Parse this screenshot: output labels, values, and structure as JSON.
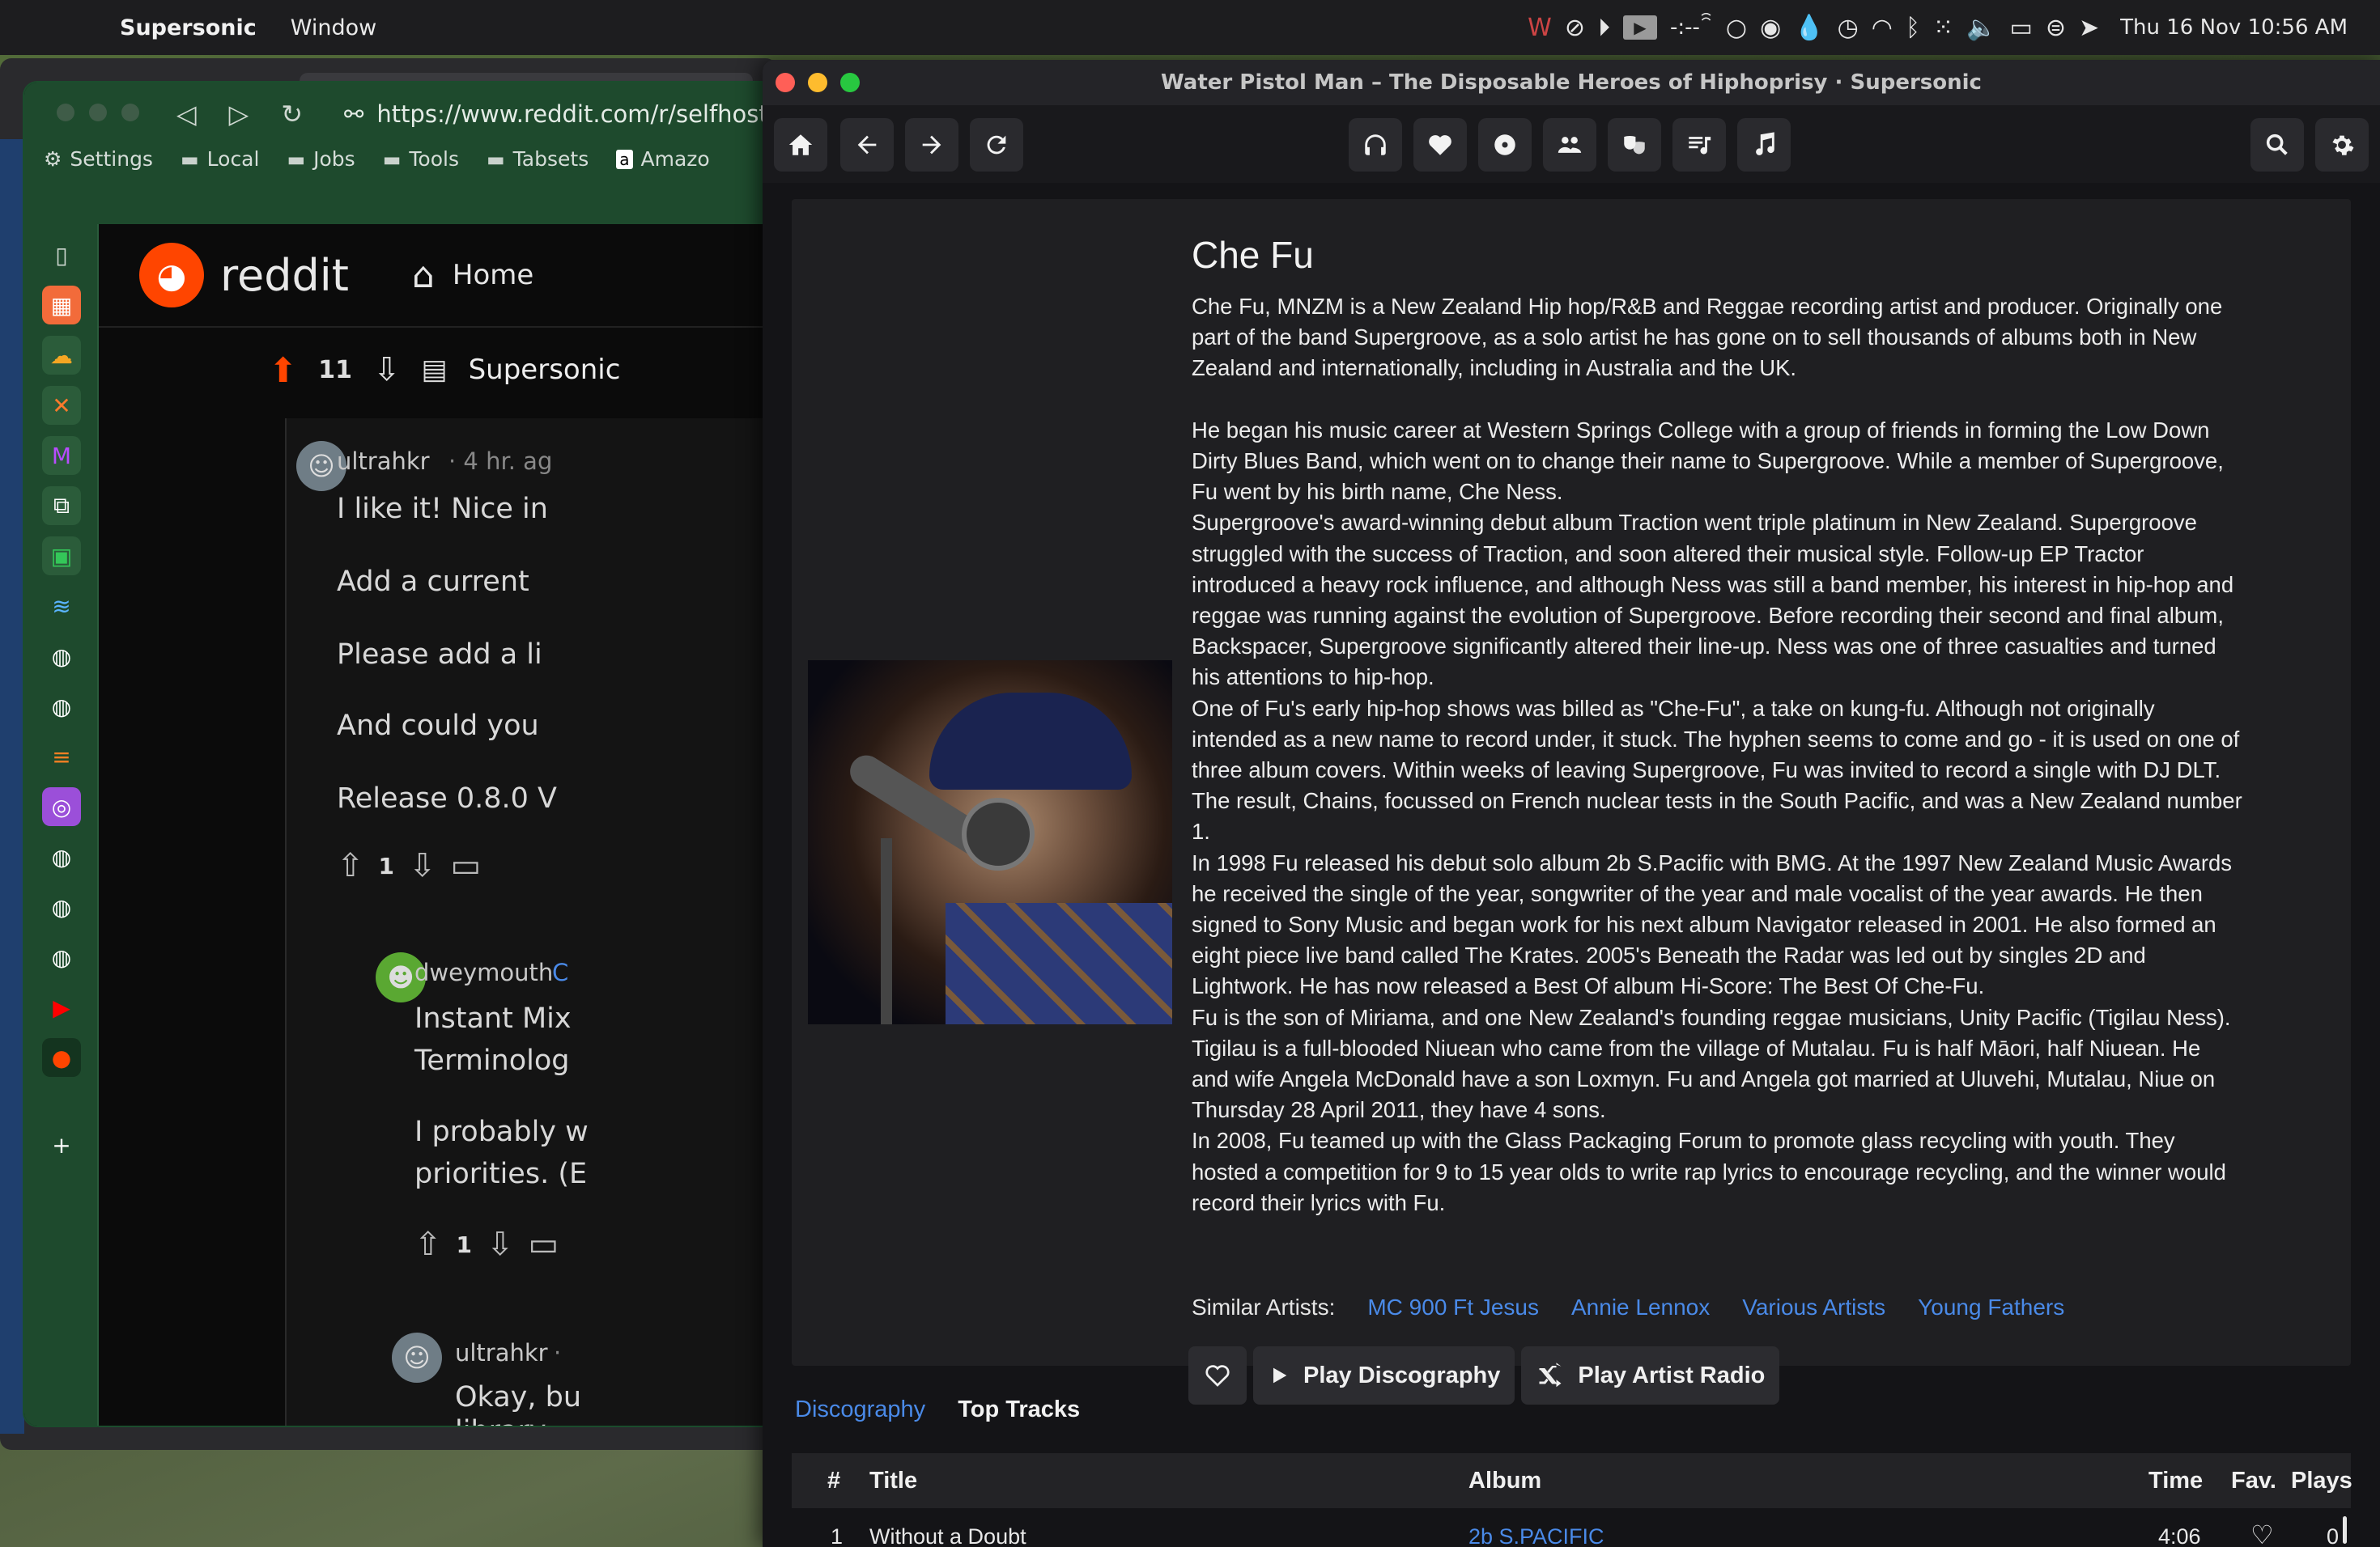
{
  "menubar": {
    "app_name": "Supersonic",
    "menu_window": "Window",
    "clock": "Thu 16 Nov  10:56 AM",
    "timer": "-:--"
  },
  "browser": {
    "url": "https://www.reddit.com/r/selfhosted",
    "bookmarks": [
      "Settings",
      "Local",
      "Jobs",
      "Tools",
      "Tabsets",
      "Amazo"
    ],
    "reddit_word": "reddit",
    "home_label": "Home",
    "post": {
      "score": "11",
      "title": "Supersonic"
    },
    "comments": {
      "c1_user": "ultrahkr",
      "c1_meta": "· 4 hr. ag",
      "c1_l1": "I like it! Nice in",
      "c1_l2": "Add a current",
      "c1_l3": "Please add a li",
      "c1_l4": "And could you",
      "c1_l5": "Release 0.8.0 V",
      "c1_votes": "1",
      "c2_user": "dweymouth",
      "c2_tag": "C",
      "c2_l1": "Instant Mix",
      "c2_l2": "Terminolog",
      "c2_l3": "I probably w",
      "c2_l4": "priorities. (E",
      "c2_votes": "1",
      "c3_user": "ultrahkr",
      "c3_meta": "·",
      "c3_l1": "Okay, bu",
      "c3_l2": "library"
    }
  },
  "sonic": {
    "window_title": "Water Pistol Man – The Disposable Heroes of Hiphoprisy · Supersonic",
    "artist_name": "Che Fu",
    "bio": "Che Fu, MNZM is a New Zealand Hip hop/R&B and Reggae recording artist and producer. Originally one\npart of the band Supergroove, as a solo artist he has gone on to sell thousands of albums both in New\nZealand and internationally, including in Australia and the UK.\n\nHe began his music career at Western Springs College with a group of friends in forming the Low Down\nDirty Blues Band, which went on to change their name to Supergroove. While a member of Supergroove,\nFu went by his birth name, Che Ness.\nSupergroove's award-winning debut album Traction went triple platinum in New Zealand. Supergroove\nstruggled with the success of Traction, and soon altered their musical style. Follow-up EP Tractor\nintroduced a heavy rock influence, and although Ness was still a band member, his interest in hip-hop and\nreggae was running against the evolution of Supergroove. Before recording their second and final album,\nBackspacer, Supergroove significantly altered their line-up. Ness was one of three casualties and turned\nhis attentions to hip-hop.\nOne of Fu's early hip-hop shows was billed as \"Che-Fu\", a take on kung-fu. Although not originally\nintended as a new name to record under, it stuck. The hyphen seems to come and go - it is used on one of\nthree album covers. Within weeks of leaving Supergroove, Fu was invited to record a single with DJ DLT.\nThe result, Chains, focussed on French nuclear tests in the South Pacific, and was a New Zealand number\n1.\nIn 1998 Fu released his debut solo album 2b S.Pacific with BMG. At the 1997 New Zealand Music Awards\nhe received the single of the year, songwriter of the year and male vocalist of the year awards. He then\nsigned to Sony Music and began work for his next album Navigator released in 2001. He also formed an\neight piece live band called The Krates. 2005's Beneath the Radar was led out by singles 2D and\nLightwork. He has now released a Best Of album Hi-Score: The Best Of Che-Fu.\nFu is the son of Miriama, and one New Zealand's founding reggae musicians, Unity Pacific (Tigilau Ness).\nTigilau is a full-blooded Niuean who came from the village of Mutalau. Fu is half Māori, half Niuean. He\nand wife Angela McDonald have a son Loxmyn. Fu and Angela got married at Uluvehi, Mutalau, Niue on\nThursday 28 April 2011, they have 4 sons.\nIn 2008, Fu teamed up with the Glass Packaging Forum to promote glass recycling with youth. They\nhosted a competition for 9 to 15 year olds to write rap lyrics to encourage recycling, and the winner would\nrecord their lyrics with Fu.",
    "similar_label": "Similar Artists:",
    "similar_artists": [
      "MC 900 Ft Jesus",
      "Annie Lennox",
      "Various Artists",
      "Young Fathers"
    ],
    "play_discography": "Play Discography",
    "play_radio": "Play Artist Radio",
    "tab_discography": "Discography",
    "tab_top_tracks": "Top Tracks",
    "columns": {
      "num": "#",
      "title": "Title",
      "album": "Album",
      "time": "Time",
      "fav": "Fav.",
      "plays": "Plays"
    },
    "first_track": {
      "num": "1",
      "title": "Without a Doubt",
      "album": "2b S.PACIFIC",
      "time": "4:06",
      "plays": "0"
    },
    "colors": {
      "accent": "#4a8ae8",
      "panel": "#1f1f22",
      "background": "#141417"
    }
  }
}
